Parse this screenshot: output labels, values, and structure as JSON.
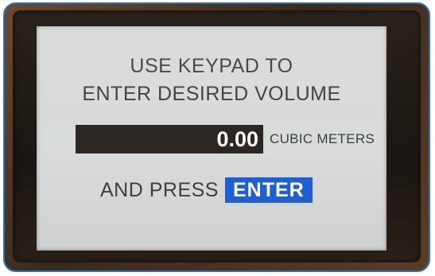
{
  "screen": {
    "line1": "USE KEYPAD TO",
    "line2": "ENTER DESIRED VOLUME",
    "volume_value": "0.00",
    "volume_unit": "CUBIC METERS",
    "press_text": "AND PRESS",
    "enter_label": "ENTER"
  },
  "colors": {
    "screen_background": "#d6d9d8",
    "value_field_background": "#2d2724",
    "enter_highlight": "#1f5fd6",
    "text": "#3d3f40",
    "frame_border": "#2f6fb8"
  }
}
